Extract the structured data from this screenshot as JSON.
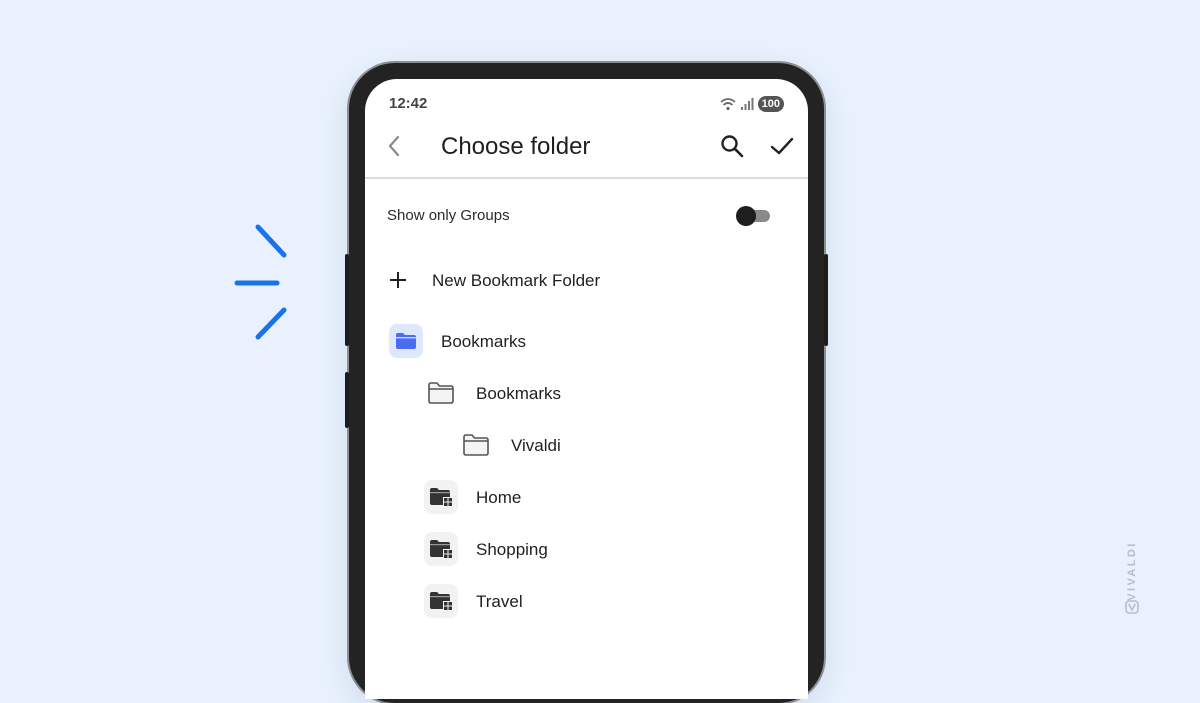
{
  "status_bar": {
    "time": "12:42",
    "battery": "100"
  },
  "app_bar": {
    "title": "Choose folder"
  },
  "toggle": {
    "label": "Show only Groups",
    "checked": false
  },
  "new_folder": {
    "label": "New Bookmark Folder"
  },
  "folders": [
    {
      "label": "Bookmarks",
      "icon": "folder-filled-blue-icon",
      "level": 0,
      "selected": true
    },
    {
      "label": "Bookmarks",
      "icon": "folder-outline-icon",
      "level": 1
    },
    {
      "label": "Vivaldi",
      "icon": "folder-outline-icon",
      "level": 2
    },
    {
      "label": "Home",
      "icon": "folder-group-icon",
      "level": 1
    },
    {
      "label": "Shopping",
      "icon": "folder-group-icon",
      "level": 1
    },
    {
      "label": "Travel",
      "icon": "folder-group-icon",
      "level": 1
    }
  ],
  "brand": {
    "name": "VIVALDI"
  },
  "colors": {
    "accent": "#1a73e8",
    "background": "#e8f1fd",
    "selected_bg": "#dfe7ff",
    "folder_blue": "#4a6cf0"
  }
}
